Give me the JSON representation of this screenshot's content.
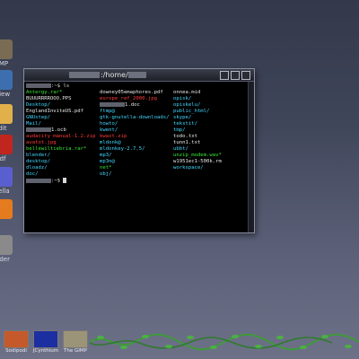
{
  "desktop_icons": [
    {
      "label": "IMP",
      "icon": "gimp-icon",
      "color": "#7a6b55"
    },
    {
      "label": "view",
      "icon": "view-icon",
      "color": "#3d6fb0"
    },
    {
      "label": "dit",
      "icon": "edit-icon",
      "color": "#e2b04a"
    },
    {
      "label": "df",
      "icon": "pdf-icon",
      "color": "#c0261e"
    },
    {
      "label": "tella",
      "icon": "stella-icon",
      "color": "#5a5fcf"
    },
    {
      "label": "",
      "icon": "blender-icon",
      "color": "#e47b1e"
    },
    {
      "label": "ader",
      "icon": "loader-icon",
      "color": "#8a8a8a"
    }
  ],
  "terminal": {
    "title_suffix": ":/home/",
    "prompt_suffix": ":~$ ",
    "command": "ls",
    "columns": [
      [
        {
          "t": "Antergy.rar*",
          "c": "green"
        },
        {
          "t": "BUUURRRROOO.PPS",
          "c": "white"
        },
        {
          "t": "Desktop/",
          "c": "cyan"
        },
        {
          "t": "EnglandInviteUS.pdf",
          "c": "white"
        },
        {
          "t": "GNUstep/",
          "c": "cyan"
        },
        {
          "t": "Mail/",
          "c": "cyan"
        },
        {
          "t": "1.ocb",
          "c": "white",
          "blur": true
        },
        {
          "t": "audacity manual-1.2.zip",
          "c": "red"
        },
        {
          "t": "avatot.jpg",
          "c": "red"
        },
        {
          "t": "bellewiltiebria.rar*",
          "c": "green"
        },
        {
          "t": "blender/",
          "c": "cyan"
        },
        {
          "t": "desktop/",
          "c": "cyan"
        },
        {
          "t": "dloadz/",
          "c": "cyan"
        },
        {
          "t": "doc/",
          "c": "cyan"
        }
      ],
      [
        {
          "t": "downey05emaphores.pdf",
          "c": "white"
        },
        {
          "t": "europe_ref_2000.jpg",
          "c": "red"
        },
        {
          "t": "1.doc",
          "c": "white",
          "blur": true
        },
        {
          "t": "ftmp@",
          "c": "cyan"
        },
        {
          "t": "gtk-gnutella-downloads/",
          "c": "cyan"
        },
        {
          "t": "howto/",
          "c": "cyan"
        },
        {
          "t": "kwent/",
          "c": "cyan"
        },
        {
          "t": "kwast.zip",
          "c": "red"
        },
        {
          "t": "mldonk@",
          "c": "cyan"
        },
        {
          "t": "mldonkey-2.7.5/",
          "c": "cyan"
        },
        {
          "t": "mp3/",
          "c": "cyan"
        },
        {
          "t": "mp3n@",
          "c": "cyan"
        },
        {
          "t": "net*",
          "c": "green"
        },
        {
          "t": "obj/",
          "c": "cyan"
        }
      ],
      [
        {
          "t": "onnea.mid",
          "c": "white"
        },
        {
          "t": "opisk/",
          "c": "cyan"
        },
        {
          "t": "opiskelu/",
          "c": "cyan"
        },
        {
          "t": "public_html/",
          "c": "cyan"
        },
        {
          "t": "skype/",
          "c": "cyan"
        },
        {
          "t": "tekstit/",
          "c": "cyan"
        },
        {
          "t": "tmp/",
          "c": "cyan"
        },
        {
          "t": "todo.txt",
          "c": "white"
        },
        {
          "t": "tunn1.txt",
          "c": "white"
        },
        {
          "t": "ubbt/",
          "c": "cyan"
        },
        {
          "t": "unzip_modem.wav*",
          "c": "green"
        },
        {
          "t": "w1951ec1-500k.rm",
          "c": "white"
        },
        {
          "t": "workspace/",
          "c": "cyan"
        }
      ]
    ]
  },
  "taskbar": {
    "items": [
      {
        "label": "Sodipodi",
        "icon": "sodipodi-task-icon",
        "color": "#c45a2b"
      },
      {
        "label": "JCynthium",
        "icon": "terminal-task-icon",
        "color": "#1c2fa0"
      },
      {
        "label": "The GIMP",
        "icon": "gimp-task-icon",
        "color": "#9c9478"
      }
    ]
  }
}
